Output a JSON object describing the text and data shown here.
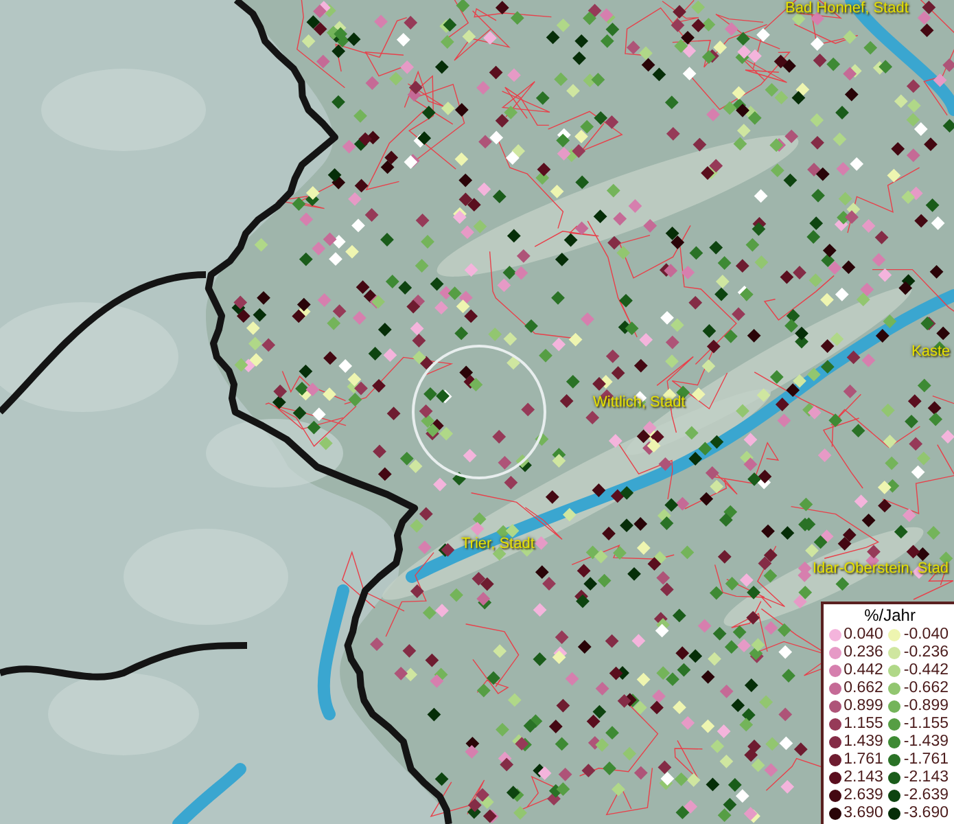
{
  "map": {
    "place_labels": [
      {
        "text": "Bad Honnef, Stadt"
      },
      {
        "text": "Kaste"
      },
      {
        "text": "Wittlich, Stadt"
      },
      {
        "text": "Trier, Stadt"
      },
      {
        "text": "Idar-Oberstein, Stad"
      }
    ]
  },
  "legend": {
    "title": "%/Jahr",
    "positive": [
      {
        "value": "0.040",
        "color": "#f4b4dc"
      },
      {
        "value": "0.236",
        "color": "#e69ac6"
      },
      {
        "value": "0.442",
        "color": "#d67fae"
      },
      {
        "value": "0.662",
        "color": "#c56a96"
      },
      {
        "value": "0.899",
        "color": "#ae5478"
      },
      {
        "value": "1.155",
        "color": "#963a58"
      },
      {
        "value": "1.439",
        "color": "#842c46"
      },
      {
        "value": "1.761",
        "color": "#6e1c30"
      },
      {
        "value": "2.143",
        "color": "#5a0e1e"
      },
      {
        "value": "2.639",
        "color": "#440812"
      },
      {
        "value": "3.690",
        "color": "#2a0408"
      }
    ],
    "negative": [
      {
        "value": "-0.040",
        "color": "#eef5b0"
      },
      {
        "value": "-0.236",
        "color": "#cfe6a0"
      },
      {
        "value": "-0.442",
        "color": "#b0d888"
      },
      {
        "value": "-0.662",
        "color": "#92c670"
      },
      {
        "value": "-0.899",
        "color": "#74b45a"
      },
      {
        "value": "-1.155",
        "color": "#569e44"
      },
      {
        "value": "-1.439",
        "color": "#3e8a34"
      },
      {
        "value": "-1.761",
        "color": "#2a7226"
      },
      {
        "value": "-2.143",
        "color": "#1a5c1a"
      },
      {
        "value": "-2.639",
        "color": "#0e4410"
      },
      {
        "value": "-3.690",
        "color": "#062e08"
      }
    ]
  }
}
